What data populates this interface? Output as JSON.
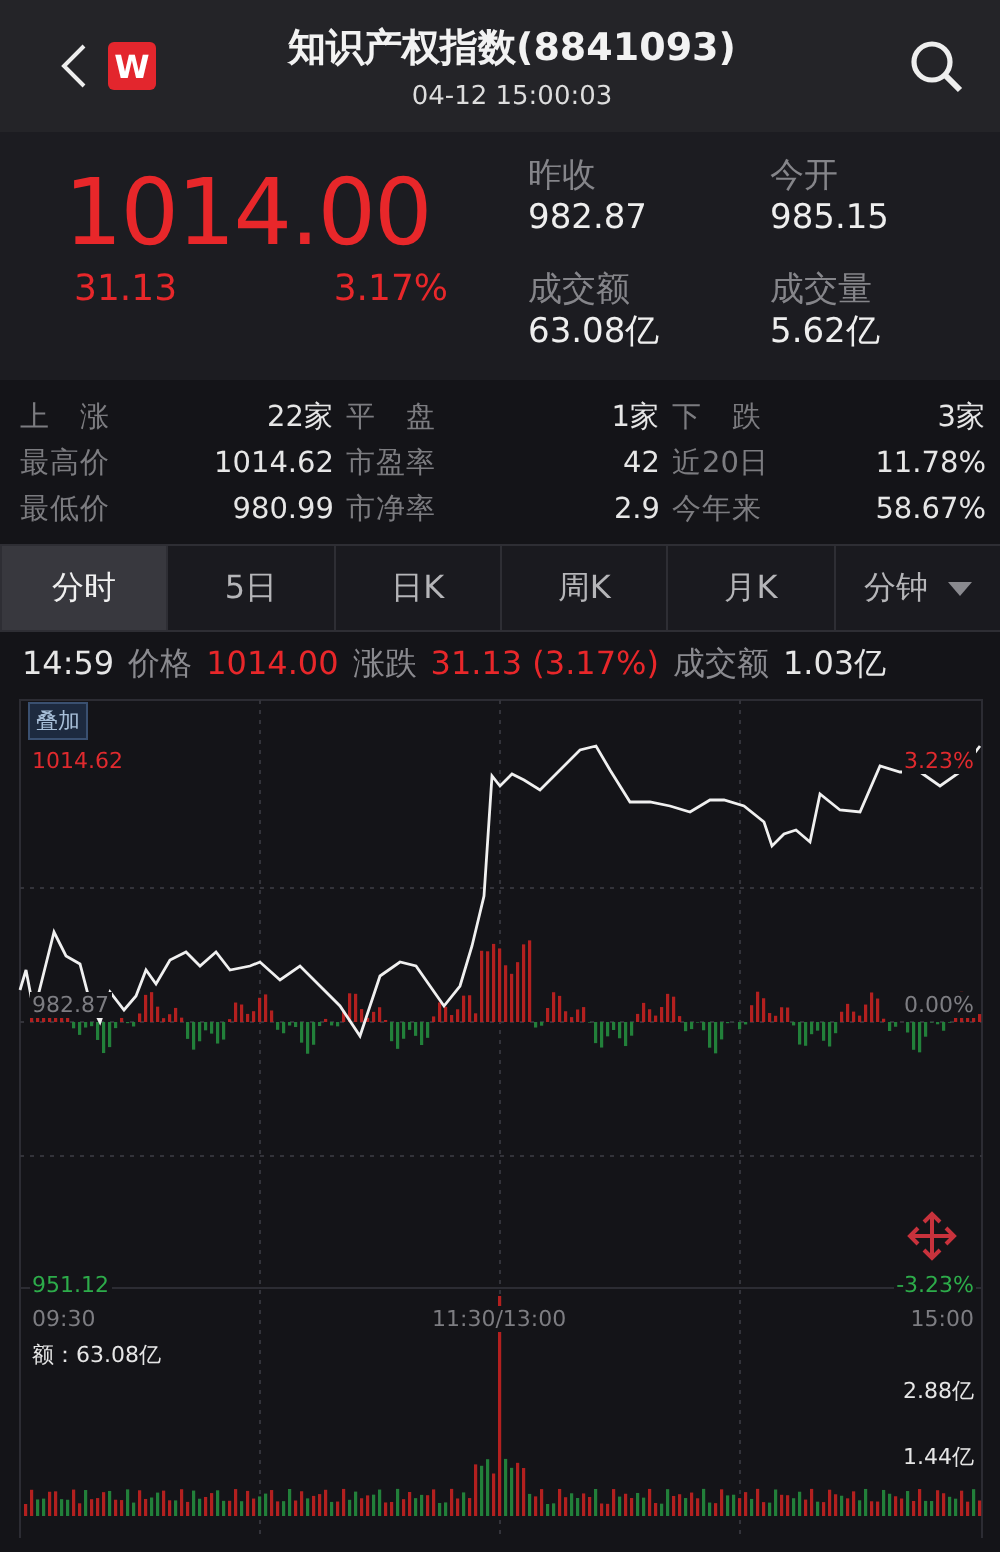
{
  "header": {
    "logo": "W",
    "title": "知识产权指数(8841093)",
    "datetime": "04-12 15:00:03"
  },
  "quote": {
    "rising": true,
    "price": "1014.00",
    "change": "31.13",
    "change_pct": "3.17%",
    "fields": [
      {
        "label": "昨收",
        "value": "982.87"
      },
      {
        "label": "今开",
        "value": "985.15"
      },
      {
        "label": "成交额",
        "value": "63.08亿"
      },
      {
        "label": "成交量",
        "value": "5.62亿"
      }
    ]
  },
  "stats": [
    {
      "label": "上　涨",
      "value": "22家"
    },
    {
      "label": "平　盘",
      "value": "1家"
    },
    {
      "label": "下　跌",
      "value": "3家"
    },
    {
      "label": "最高价",
      "value": "1014.62"
    },
    {
      "label": "市盈率",
      "value": "42"
    },
    {
      "label": "近20日",
      "value": "11.78%"
    },
    {
      "label": "最低价",
      "value": "980.99"
    },
    {
      "label": "市净率",
      "value": "2.9"
    },
    {
      "label": "今年来",
      "value": "58.67%"
    }
  ],
  "tabs": [
    {
      "label": "分时",
      "selected": true,
      "dropdown": false
    },
    {
      "label": "5日",
      "selected": false,
      "dropdown": false
    },
    {
      "label": "日K",
      "selected": false,
      "dropdown": false
    },
    {
      "label": "周K",
      "selected": false,
      "dropdown": false
    },
    {
      "label": "月K",
      "selected": false,
      "dropdown": false
    },
    {
      "label": "分钟",
      "selected": false,
      "dropdown": true
    }
  ],
  "info_line": [
    {
      "kind": "time",
      "text": "14:59"
    },
    {
      "kind": "label",
      "text": "价格"
    },
    {
      "kind": "up",
      "text": "1014.00"
    },
    {
      "kind": "label",
      "text": "涨跌"
    },
    {
      "kind": "up",
      "text": "31.13 (3.17%)"
    },
    {
      "kind": "label",
      "text": "成交额"
    },
    {
      "kind": "value",
      "text": "1.03亿"
    }
  ],
  "chart": {
    "overlay_button": "叠加",
    "max_price": "1014.62",
    "max_pct": "3.23%",
    "base_price": "982.87",
    "base_pct": "0.00%",
    "min_price": "951.12",
    "min_pct": "-3.23%",
    "times": [
      "09:30",
      "11:30/13:00",
      "15:00"
    ],
    "volume_total": "额：63.08亿",
    "volume_ticks": [
      "2.88亿",
      "1.44亿"
    ]
  }
}
